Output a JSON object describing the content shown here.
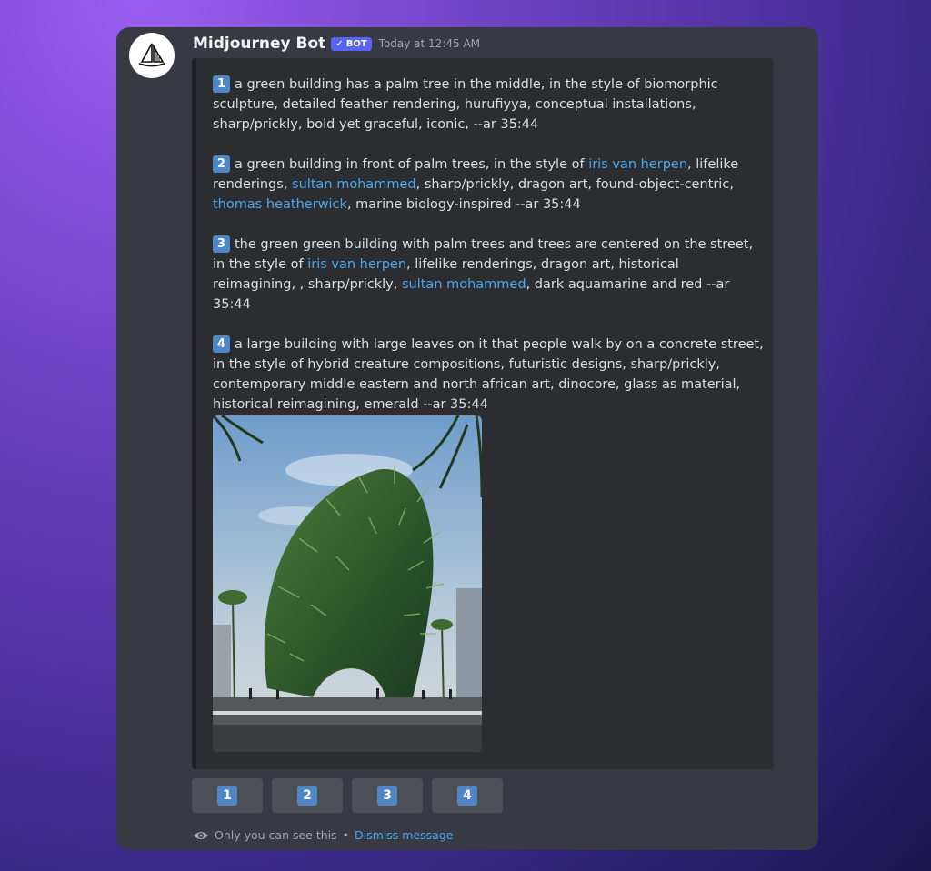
{
  "message": {
    "author": "Midjourney Bot",
    "badge": "BOT",
    "timestamp": "Today at 12:45 AM"
  },
  "prompts": [
    {
      "number": "1",
      "segments": [
        {
          "text": "a green building has a palm tree in the middle, in the style of biomorphic sculpture, detailed feather rendering, hurufiyya, conceptual installations, sharp/prickly, bold yet graceful, iconic, --ar 35:44",
          "link": false
        }
      ]
    },
    {
      "number": "2",
      "segments": [
        {
          "text": "a green building in front of palm trees, in the style of ",
          "link": false
        },
        {
          "text": "iris van herpen",
          "link": true
        },
        {
          "text": ", lifelike renderings, ",
          "link": false
        },
        {
          "text": "sultan mohammed",
          "link": true
        },
        {
          "text": ", sharp/prickly, dragon art, found-object-centric, ",
          "link": false
        },
        {
          "text": "thomas heatherwick",
          "link": true
        },
        {
          "text": ", marine biology-inspired --ar 35:44",
          "link": false
        }
      ]
    },
    {
      "number": "3",
      "segments": [
        {
          "text": "the green green building with palm trees and trees are centered on the street, in the style of ",
          "link": false
        },
        {
          "text": "iris van herpen",
          "link": true
        },
        {
          "text": ", lifelike renderings, dragon art, historical reimagining, , sharp/prickly, ",
          "link": false
        },
        {
          "text": "sultan mohammed",
          "link": true
        },
        {
          "text": ", dark aquamarine and red --ar 35:44",
          "link": false
        }
      ]
    },
    {
      "number": "4",
      "segments": [
        {
          "text": "a large building with large leaves on it that people walk by on a concrete street, in the style of hybrid creature compositions, futuristic designs, sharp/prickly, contemporary middle eastern and north african art, dinocore, glass as material, historical reimagining, emerald --ar 35:44",
          "link": false
        }
      ]
    }
  ],
  "buttons": [
    "1",
    "2",
    "3",
    "4"
  ],
  "footer": {
    "visibility_text": "Only you can see this",
    "separator": "•",
    "dismiss_label": "Dismiss message"
  },
  "colors": {
    "badge": "#5865f2",
    "link": "#4ba8f0",
    "number_badge": "#4f86c6"
  }
}
